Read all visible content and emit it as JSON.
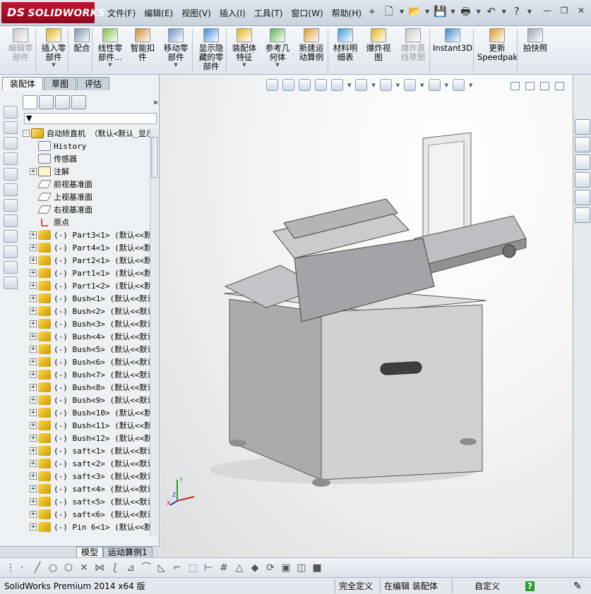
{
  "window": {
    "logo_text": "SOLIDWORKS",
    "logo_mark": "DS",
    "menu": [
      "文件(F)",
      "编辑(E)",
      "视图(V)",
      "插入(I)",
      "工具(T)",
      "窗口(W)",
      "帮助(H)"
    ]
  },
  "command_bar": {
    "buttons": [
      {
        "label": "编辑零\n部件",
        "disabled": true,
        "has_dropdown": false
      },
      {
        "label": "插入零\n部件",
        "disabled": false,
        "has_dropdown": true
      },
      {
        "label": "配合",
        "disabled": false,
        "has_dropdown": false
      },
      {
        "label": "线性零\n部件...",
        "disabled": false,
        "has_dropdown": true
      },
      {
        "label": "智能扣\n件",
        "disabled": false,
        "has_dropdown": false
      },
      {
        "label": "移动零\n部件",
        "disabled": false,
        "has_dropdown": true
      },
      {
        "label": "显示隐\n藏的零\n部件",
        "disabled": false,
        "has_dropdown": false
      },
      {
        "label": "装配体\n特征",
        "disabled": false,
        "has_dropdown": true
      },
      {
        "label": "参考几\n何体",
        "disabled": false,
        "has_dropdown": true
      },
      {
        "label": "新建运\n动算例",
        "disabled": false,
        "has_dropdown": false
      },
      {
        "label": "材料明\n细表",
        "disabled": false,
        "has_dropdown": false
      },
      {
        "label": "爆炸视\n图",
        "disabled": false,
        "has_dropdown": false
      },
      {
        "label": "爆炸直\n线草图",
        "disabled": true,
        "has_dropdown": false
      },
      {
        "label": "Instant3D",
        "disabled": false,
        "has_dropdown": false
      },
      {
        "label": "更新\nSpeedpak",
        "disabled": false,
        "has_dropdown": false
      },
      {
        "label": "拍快照",
        "disabled": false,
        "has_dropdown": false
      }
    ]
  },
  "panel": {
    "tabs": [
      "装配体",
      "草图",
      "评估"
    ],
    "active_tab": "装配体",
    "more_symbol": "»",
    "tree": [
      {
        "type": "asm",
        "text": "自动矫直机 （默认<默认_显示",
        "expander": "-"
      },
      {
        "type": "folder",
        "text": "History",
        "expander": ""
      },
      {
        "type": "folder",
        "text": "传感器",
        "expander": ""
      },
      {
        "type": "note",
        "text": "注解",
        "expander": "+"
      },
      {
        "type": "plane",
        "text": "前视基准面",
        "expander": ""
      },
      {
        "type": "plane",
        "text": "上视基准面",
        "expander": ""
      },
      {
        "type": "plane",
        "text": "右视基准面",
        "expander": ""
      },
      {
        "type": "origin",
        "text": "原点",
        "expander": ""
      },
      {
        "type": "part",
        "text": "(-) Part3<1> (默认<<默认",
        "expander": "+"
      },
      {
        "type": "part",
        "text": "(-) Part4<1> (默认<<默认",
        "expander": "+"
      },
      {
        "type": "part",
        "text": "(-) Part2<1> (默认<<默认",
        "expander": "+"
      },
      {
        "type": "part",
        "text": "(-) Part1<1> (默认<<默认",
        "expander": "+"
      },
      {
        "type": "part",
        "text": "(-) Part1<2> (默认<<默认",
        "expander": "+"
      },
      {
        "type": "part",
        "text": "(-) Bush<1> (默认<<默认",
        "expander": "+"
      },
      {
        "type": "part",
        "text": "(-) Bush<2> (默认<<默认",
        "expander": "+"
      },
      {
        "type": "part",
        "text": "(-) Bush<3> (默认<<默认",
        "expander": "+"
      },
      {
        "type": "part",
        "text": "(-) Bush<4> (默认<<默认",
        "expander": "+"
      },
      {
        "type": "part",
        "text": "(-) Bush<5> (默认<<默认",
        "expander": "+"
      },
      {
        "type": "part",
        "text": "(-) Bush<6> (默认<<默认",
        "expander": "+"
      },
      {
        "type": "part",
        "text": "(-) Bush<7> (默认<<默认",
        "expander": "+"
      },
      {
        "type": "part",
        "text": "(-) Bush<8> (默认<<默认",
        "expander": "+"
      },
      {
        "type": "part",
        "text": "(-) Bush<9> (默认<<默认",
        "expander": "+"
      },
      {
        "type": "part",
        "text": "(-) Bush<10> (默认<<默认",
        "expander": "+"
      },
      {
        "type": "part",
        "text": "(-) Bush<11> (默认<<默认",
        "expander": "+"
      },
      {
        "type": "part",
        "text": "(-) Bush<12> (默认<<默认",
        "expander": "+"
      },
      {
        "type": "part",
        "text": "(-) saft<1> (默认<<默认",
        "expander": "+"
      },
      {
        "type": "part",
        "text": "(-) saft<2> (默认<<默认",
        "expander": "+"
      },
      {
        "type": "part",
        "text": "(-) saft<3> (默认<<默认",
        "expander": "+"
      },
      {
        "type": "part",
        "text": "(-) saft<4> (默认<<默认",
        "expander": "+"
      },
      {
        "type": "part",
        "text": "(-) saft<5> (默认<<默认",
        "expander": "+"
      },
      {
        "type": "part",
        "text": "(-) saft<6> (默认<<默认",
        "expander": "+"
      },
      {
        "type": "part",
        "text": "(-) Pin 6<1> (默认<<默认",
        "expander": "+"
      }
    ],
    "bottom_tabs": [
      "模型",
      "运动算例1"
    ],
    "active_bottom_tab": "模型"
  },
  "viewport": {
    "triad": {
      "x": "X",
      "y": "Y",
      "z": "Z"
    }
  },
  "status_bar": {
    "product": "SolidWorks Premium 2014 x64 版",
    "definition": "完全定义",
    "mode": "在编辑 装配体",
    "units": "自定义",
    "help_icon": "?"
  },
  "colors": {
    "logo_red": "#c8102e",
    "cabinet_grey": "#c8c9cb",
    "part_yellow": "#f2c300"
  }
}
